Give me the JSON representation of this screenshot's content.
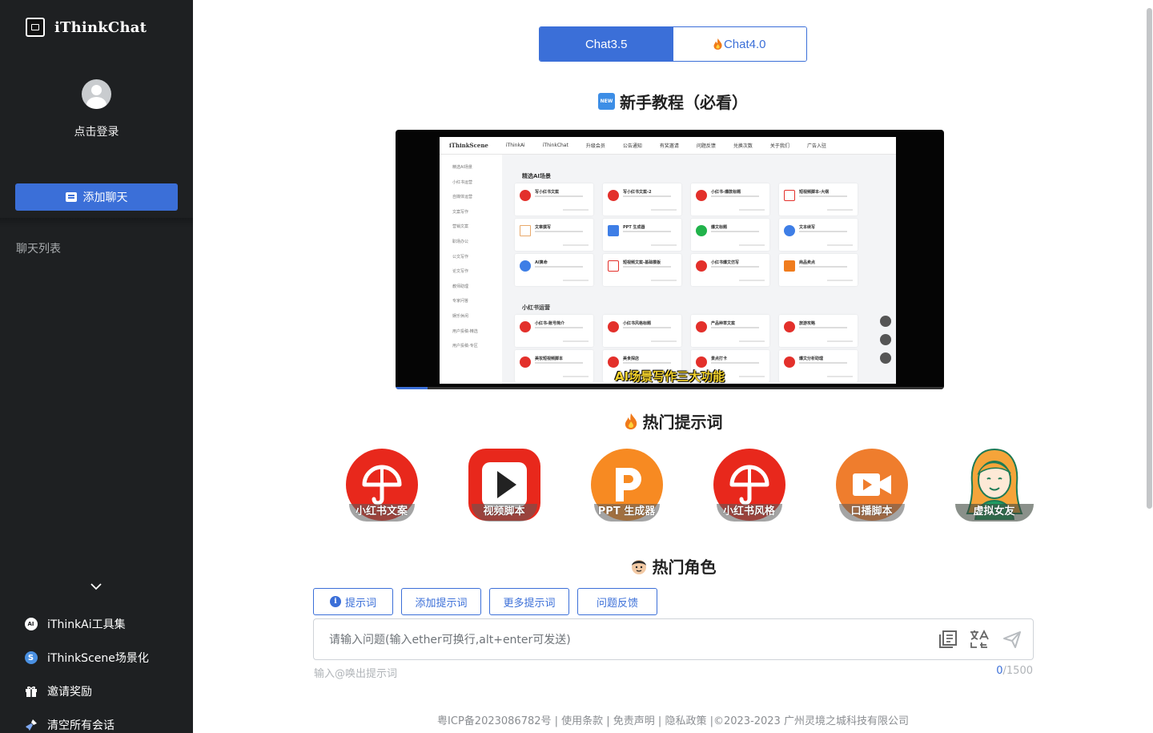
{
  "sidebar": {
    "brand": "iThinkChat",
    "login": "点击登录",
    "add_chat": "添加聊天",
    "chat_list_label": "聊天列表",
    "links": [
      {
        "label": "iThinkAi工具集",
        "icon": "ai-icon"
      },
      {
        "label": "iThinkScene场景化",
        "icon": "scene-icon"
      },
      {
        "label": "邀请奖励",
        "icon": "gift-icon"
      },
      {
        "label": "清空所有会话",
        "icon": "broom-icon"
      }
    ]
  },
  "tabs": {
    "chat35": "Chat3.5",
    "chat40": "Chat4.0",
    "active": "Chat3.5"
  },
  "tutorial": {
    "badge": "NEW",
    "title": "新手教程（必看）"
  },
  "video": {
    "subtitle": "AI场景写作三大功能",
    "screen": {
      "brand": "iThinkScene",
      "nav": [
        "iThinkAi",
        "iThinkChat",
        "升级会员",
        "公告通知",
        "有奖邀请",
        "问题反馈",
        "兑换次数",
        "关于我们",
        "广告入驻"
      ],
      "side": [
        "精选AI场景",
        "小红书运营",
        "自媒体运营",
        "文案写作",
        "营销文案",
        "职场办公",
        "公文写作",
        "论文写作",
        "教师助理",
        "专家问答",
        "娱乐休闲",
        "用户投稿-精选",
        "用户投稿-专区"
      ],
      "section1": "精选AI场景",
      "section2": "小红书运营",
      "cards": [
        "写小红书文案",
        "写小红书文案-2",
        "小红书-爆款标题",
        "短视频脚本-大纲",
        "文章撰写",
        "PPT 生成器",
        "爆文标题",
        "文本续写",
        "AI算命",
        "短视频文案-基础模板",
        "小红书爆文仿写",
        "商品卖点",
        "小红书-账号简介",
        "小红书风格标题",
        "产品种草文案",
        "旅游攻略",
        "美妆短视频脚本",
        "美食探店",
        "景点打卡",
        "爆文分析助理"
      ]
    }
  },
  "hot_prompts": {
    "title": "热门提示词",
    "items": [
      {
        "label": "小红书文案",
        "icon": "umbrella-icon",
        "color": "#e8281c"
      },
      {
        "label": "视频脚本",
        "icon": "play-icon",
        "color": "#e8281c"
      },
      {
        "label": "PPT 生成器",
        "icon": "ppt-icon",
        "color": "#f78a22"
      },
      {
        "label": "小红书风格",
        "icon": "umbrella-icon",
        "color": "#e8281c"
      },
      {
        "label": "口播脚本",
        "icon": "video-camera-icon",
        "color": "#ef7d2d"
      },
      {
        "label": "虚拟女友",
        "icon": "girl-avatar-icon",
        "color": "#1f9e63"
      }
    ]
  },
  "hot_roles": {
    "title": "热门角色"
  },
  "role_buttons": [
    "提示词",
    "添加提示词",
    "更多提示词",
    "问题反馈"
  ],
  "input": {
    "placeholder": "请输入问题(输入ether可换行,alt+enter可发送)",
    "value": "",
    "hint": "输入@唤出提示词",
    "count": "0",
    "max": "/1500"
  },
  "footer": "粤ICP备2023086782号 | 使用条款 | 免责声明 | 隐私政策 |©2023-2023 广州灵境之城科技有限公司",
  "colors": {
    "accent": "#3b6fd8",
    "sidebar_bg": "#1e2022",
    "red": "#e8281c",
    "orange": "#f78a22"
  }
}
